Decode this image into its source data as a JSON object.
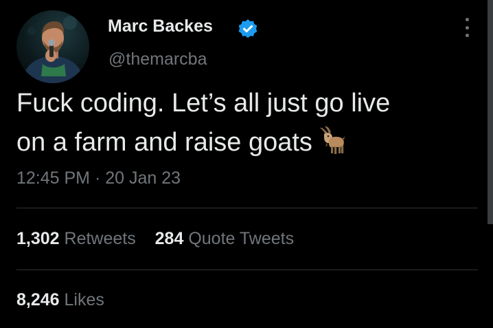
{
  "author": {
    "display_name": "Marc Backes",
    "handle": "@themarcba",
    "verified": true
  },
  "tweet": {
    "text": "Fuck coding. Let’s all just go live\non a farm and raise goats",
    "emoji": "goat-icon",
    "time": "12:45 PM",
    "separator": "·",
    "date": "20 Jan 23"
  },
  "stats": {
    "retweets_count": "1,302",
    "retweets_label": "Retweets",
    "quote_tweets_count": "284",
    "quote_tweets_label": "Quote Tweets",
    "likes_count": "8,246",
    "likes_label": "Likes"
  },
  "colors": {
    "background": "#000000",
    "primary_text": "#e7e9ea",
    "secondary_text": "#71767b",
    "verified": "#1d9bf0",
    "divider": "#2f3336"
  }
}
